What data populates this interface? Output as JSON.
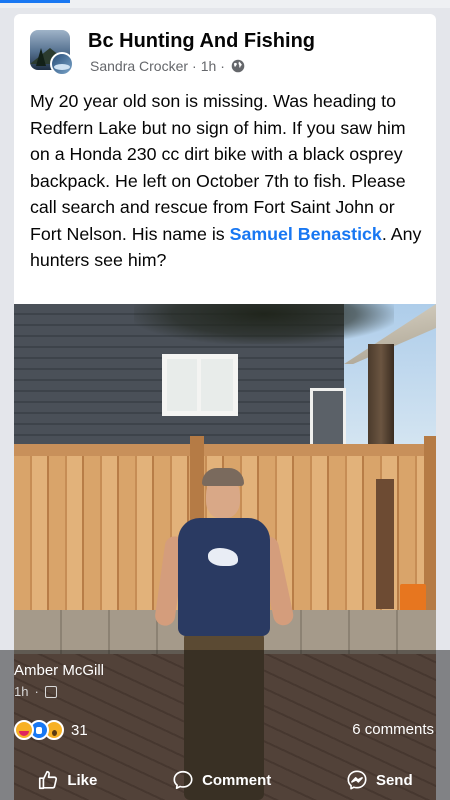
{
  "post": {
    "group_name": "Bc Hunting And Fishing",
    "author": "Sandra Crocker",
    "time": "1h",
    "separator": "·",
    "body_before": "My 20 year old son is missing.  Was heading to Redfern Lake but no sign of him. If you saw him on a Honda 230 cc dirt bike with a black osprey backpack.  He left on October 7th to fish.  Please call search and rescue from Fort Saint John or Fort Nelson. His name is ",
    "body_link": "Samuel Benastick",
    "body_after": ". Any hunters see him?"
  },
  "overlay": {
    "sharer_name": "Amber McGill",
    "sharer_time": "1h",
    "separator": "·"
  },
  "engagement": {
    "reaction_count": "31",
    "comments": "6 comments"
  },
  "actions": {
    "like": "Like",
    "comment": "Comment",
    "send": "Send"
  },
  "colors": {
    "link": "#1877f2",
    "meta": "#65676b"
  }
}
